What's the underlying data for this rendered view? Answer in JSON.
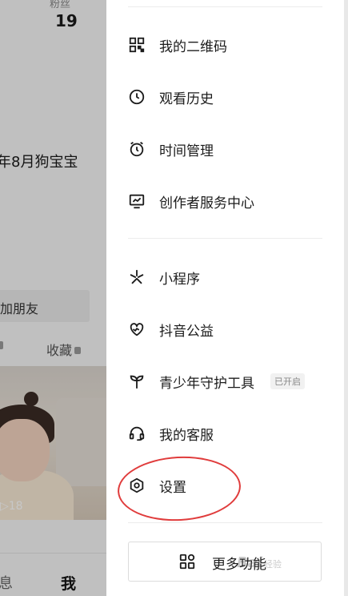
{
  "background_profile": {
    "fans_label": "粉丝",
    "fans_value": "19",
    "bio_text": "年8月狗宝宝",
    "add_friend_label": "加朋友",
    "favorites_tab_label": "收藏",
    "video_play_count": "▷18",
    "bottom_nav": {
      "messages_label": "息",
      "me_label": "我"
    }
  },
  "drawer": {
    "menu_group_1": [
      {
        "label": "我的二维码",
        "icon": "qr-code-icon"
      },
      {
        "label": "观看历史",
        "icon": "clock-icon"
      },
      {
        "label": "时间管理",
        "icon": "alarm-clock-icon"
      },
      {
        "label": "创作者服务中心",
        "icon": "chart-monitor-icon"
      }
    ],
    "menu_group_2": [
      {
        "label": "小程序",
        "icon": "asterisk-icon"
      },
      {
        "label": "抖音公益",
        "icon": "charity-heart-icon"
      },
      {
        "label": "青少年守护工具",
        "icon": "sprout-icon",
        "badge": "已开启"
      },
      {
        "label": "我的客服",
        "icon": "headset-icon"
      },
      {
        "label": "设置",
        "icon": "hexagon-gear-icon"
      }
    ],
    "more_features_label": "更多功能",
    "more_features_icon": "grid-apps-icon"
  },
  "watermark": {
    "brand": "Bai",
    "suffix": "经验"
  },
  "colors": {
    "highlight_circle": "#e03c3c",
    "text_primary": "#1c1c1c"
  }
}
